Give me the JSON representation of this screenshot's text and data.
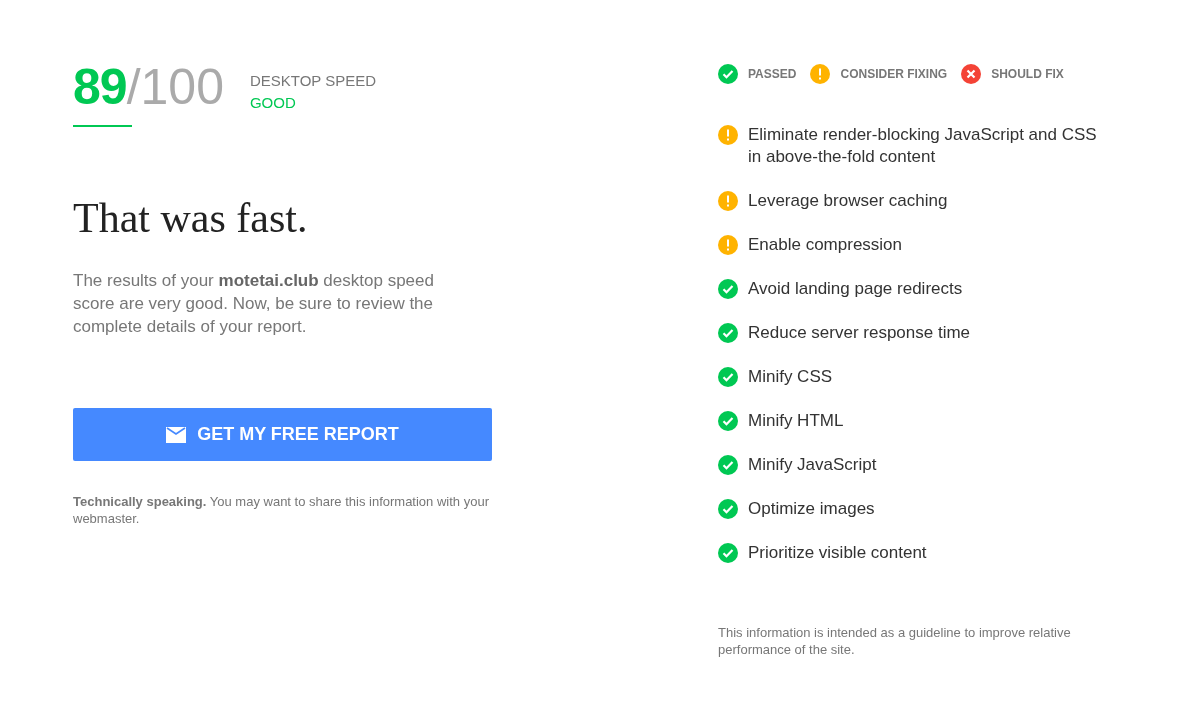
{
  "score": {
    "value": "89",
    "max": "/100",
    "label": "DESKTOP SPEED",
    "rating": "GOOD"
  },
  "headline": "That was fast.",
  "summary": "The results of your **motetai.club** desktop speed score are very good. Now, be sure to review the complete details of your report.",
  "report_button": {
    "label": "GET MY FREE REPORT"
  },
  "technical_note": "**Technically speaking.** You may want to share this information with your webmaster.",
  "legend": [
    {
      "kind": "passed",
      "label": "PASSED"
    },
    {
      "kind": "consider",
      "label": "CONSIDER FIXING"
    },
    {
      "kind": "fix",
      "label": "SHOULD FIX"
    }
  ],
  "checks": [
    {
      "kind": "consider",
      "label": "Eliminate render-blocking JavaScript and CSS in above-the-fold content"
    },
    {
      "kind": "consider",
      "label": "Leverage browser caching"
    },
    {
      "kind": "consider",
      "label": "Enable compression"
    },
    {
      "kind": "passed",
      "label": "Avoid landing page redirects"
    },
    {
      "kind": "passed",
      "label": "Reduce server response time"
    },
    {
      "kind": "passed",
      "label": "Minify CSS"
    },
    {
      "kind": "passed",
      "label": "Minify HTML"
    },
    {
      "kind": "passed",
      "label": "Minify JavaScript"
    },
    {
      "kind": "passed",
      "label": "Optimize images"
    },
    {
      "kind": "passed",
      "label": "Prioritize visible content"
    }
  ],
  "footnote": "This information is intended as a guideline to improve relative performance of the site."
}
